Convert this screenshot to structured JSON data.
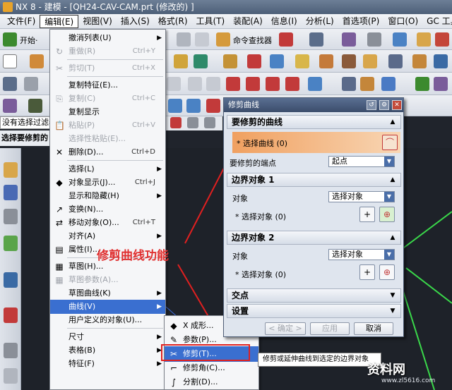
{
  "app": {
    "title": "NX 8 - 建模 - [QH24-CAV-CAM.prt  (修改的)  ]"
  },
  "menubar": {
    "items": [
      "文件(F)",
      "编辑(E)",
      "视图(V)",
      "插入(S)",
      "格式(R)",
      "工具(T)",
      "装配(A)",
      "信息(I)",
      "分析(L)",
      "首选项(P)",
      "窗口(O)",
      "GC 工具箱"
    ],
    "active_index": 1
  },
  "toolbar": {
    "start_label": "开始·",
    "cmd_finder_label": "命令查找器"
  },
  "status": {
    "selection_filter": "没有选择过滤器",
    "prompt": "选择要修剪的"
  },
  "edit_menu": {
    "items": [
      {
        "label": "撤消列表(U)",
        "shortcut": "",
        "submenu": true,
        "disabled": false,
        "icon": ""
      },
      {
        "label": "重做(R)",
        "shortcut": "Ctrl+Y",
        "submenu": false,
        "disabled": true,
        "icon": "↻"
      },
      {
        "sep": true
      },
      {
        "label": "剪切(T)",
        "shortcut": "Ctrl+X",
        "submenu": false,
        "disabled": true,
        "icon": "✂"
      },
      {
        "sep": true
      },
      {
        "label": "复制特征(E)...",
        "shortcut": "",
        "submenu": false,
        "disabled": false,
        "icon": ""
      },
      {
        "label": "复制(C)",
        "shortcut": "Ctrl+C",
        "submenu": false,
        "disabled": true,
        "icon": "⎘"
      },
      {
        "label": "复制显示",
        "shortcut": "",
        "submenu": false,
        "disabled": false,
        "icon": ""
      },
      {
        "label": "粘贴(P)",
        "shortcut": "Ctrl+V",
        "submenu": false,
        "disabled": true,
        "icon": "📋"
      },
      {
        "label": "选择性粘贴(E)...",
        "shortcut": "",
        "submenu": false,
        "disabled": true,
        "icon": ""
      },
      {
        "label": "删除(D)...",
        "shortcut": "Ctrl+D",
        "submenu": false,
        "disabled": false,
        "icon": "✕"
      },
      {
        "sep": true
      },
      {
        "label": "选择(L)",
        "shortcut": "",
        "submenu": true,
        "disabled": false,
        "icon": ""
      },
      {
        "label": "对象显示(J)...",
        "shortcut": "Ctrl+J",
        "submenu": false,
        "disabled": false,
        "icon": "◆"
      },
      {
        "label": "显示和隐藏(H)",
        "shortcut": "",
        "submenu": true,
        "disabled": false,
        "icon": ""
      },
      {
        "label": "变换(N)...",
        "shortcut": "",
        "submenu": false,
        "disabled": false,
        "icon": "↗"
      },
      {
        "label": "移动对象(O)...",
        "shortcut": "Ctrl+T",
        "submenu": false,
        "disabled": false,
        "icon": "⇄"
      },
      {
        "label": "对齐(A)",
        "shortcut": "",
        "submenu": true,
        "disabled": false,
        "icon": ""
      },
      {
        "label": "属性(I)...",
        "shortcut": "",
        "submenu": false,
        "disabled": false,
        "icon": "▤"
      },
      {
        "sep": true
      },
      {
        "label": "草图(H)...",
        "shortcut": "",
        "submenu": false,
        "disabled": false,
        "icon": "▦"
      },
      {
        "label": "草图参数(A)...",
        "shortcut": "",
        "submenu": false,
        "disabled": true,
        "icon": "▦"
      },
      {
        "label": "草图曲线(K)",
        "shortcut": "",
        "submenu": true,
        "disabled": false,
        "icon": ""
      },
      {
        "label": "曲线(V)",
        "shortcut": "",
        "submenu": true,
        "disabled": false,
        "icon": "",
        "highlight": true
      },
      {
        "label": "用户定义的对象(U)...",
        "shortcut": "",
        "submenu": false,
        "disabled": false,
        "icon": ""
      },
      {
        "sep": true
      },
      {
        "label": "尺寸",
        "shortcut": "",
        "submenu": true,
        "disabled": false,
        "icon": ""
      },
      {
        "label": "表格(B)",
        "shortcut": "",
        "submenu": true,
        "disabled": false,
        "icon": ""
      },
      {
        "label": "特征(F)",
        "shortcut": "",
        "submenu": true,
        "disabled": false,
        "icon": ""
      }
    ]
  },
  "curve_submenu": {
    "items": [
      {
        "label": "X 成形...",
        "icon": "◆"
      },
      {
        "label": "参数(P)...",
        "icon": "✎"
      },
      {
        "label": "修剪(T)...",
        "icon": "✂",
        "highlight": true
      },
      {
        "label": "修剪角(C)...",
        "icon": "⌐"
      },
      {
        "label": "分割(D)...",
        "icon": "∫"
      }
    ]
  },
  "tooltip": "修剪或延伸曲线到选定的边界对象",
  "annotation": "修剪曲线功能",
  "dialog": {
    "title": "修剪曲线",
    "sections": [
      {
        "title": "要修剪的曲线"
      },
      {
        "title": "边界对象 1"
      },
      {
        "title": "边界对象 2"
      },
      {
        "title": "交点"
      },
      {
        "title": "设置"
      }
    ],
    "curve_section": {
      "select_label": "* 选择曲线 (0)",
      "endpoint_label": "要修剪的端点",
      "endpoint_value": "起点"
    },
    "boundary1": {
      "object_label": "对象",
      "object_value": "选择对象",
      "select_label": "* 选择对象 (0)"
    },
    "boundary2": {
      "object_label": "对象",
      "object_value": "选择对象",
      "select_label": "* 选择对象 (0)"
    },
    "buttons": {
      "ok": "< 确定 >",
      "apply": "应用",
      "cancel": "取消"
    }
  },
  "watermark": {
    "text": "资料网",
    "url": "www.zl5616.com"
  },
  "colors": {
    "highlight": "#3a6fd0",
    "annotation": "#e03030",
    "viewport": "#1e2229"
  }
}
